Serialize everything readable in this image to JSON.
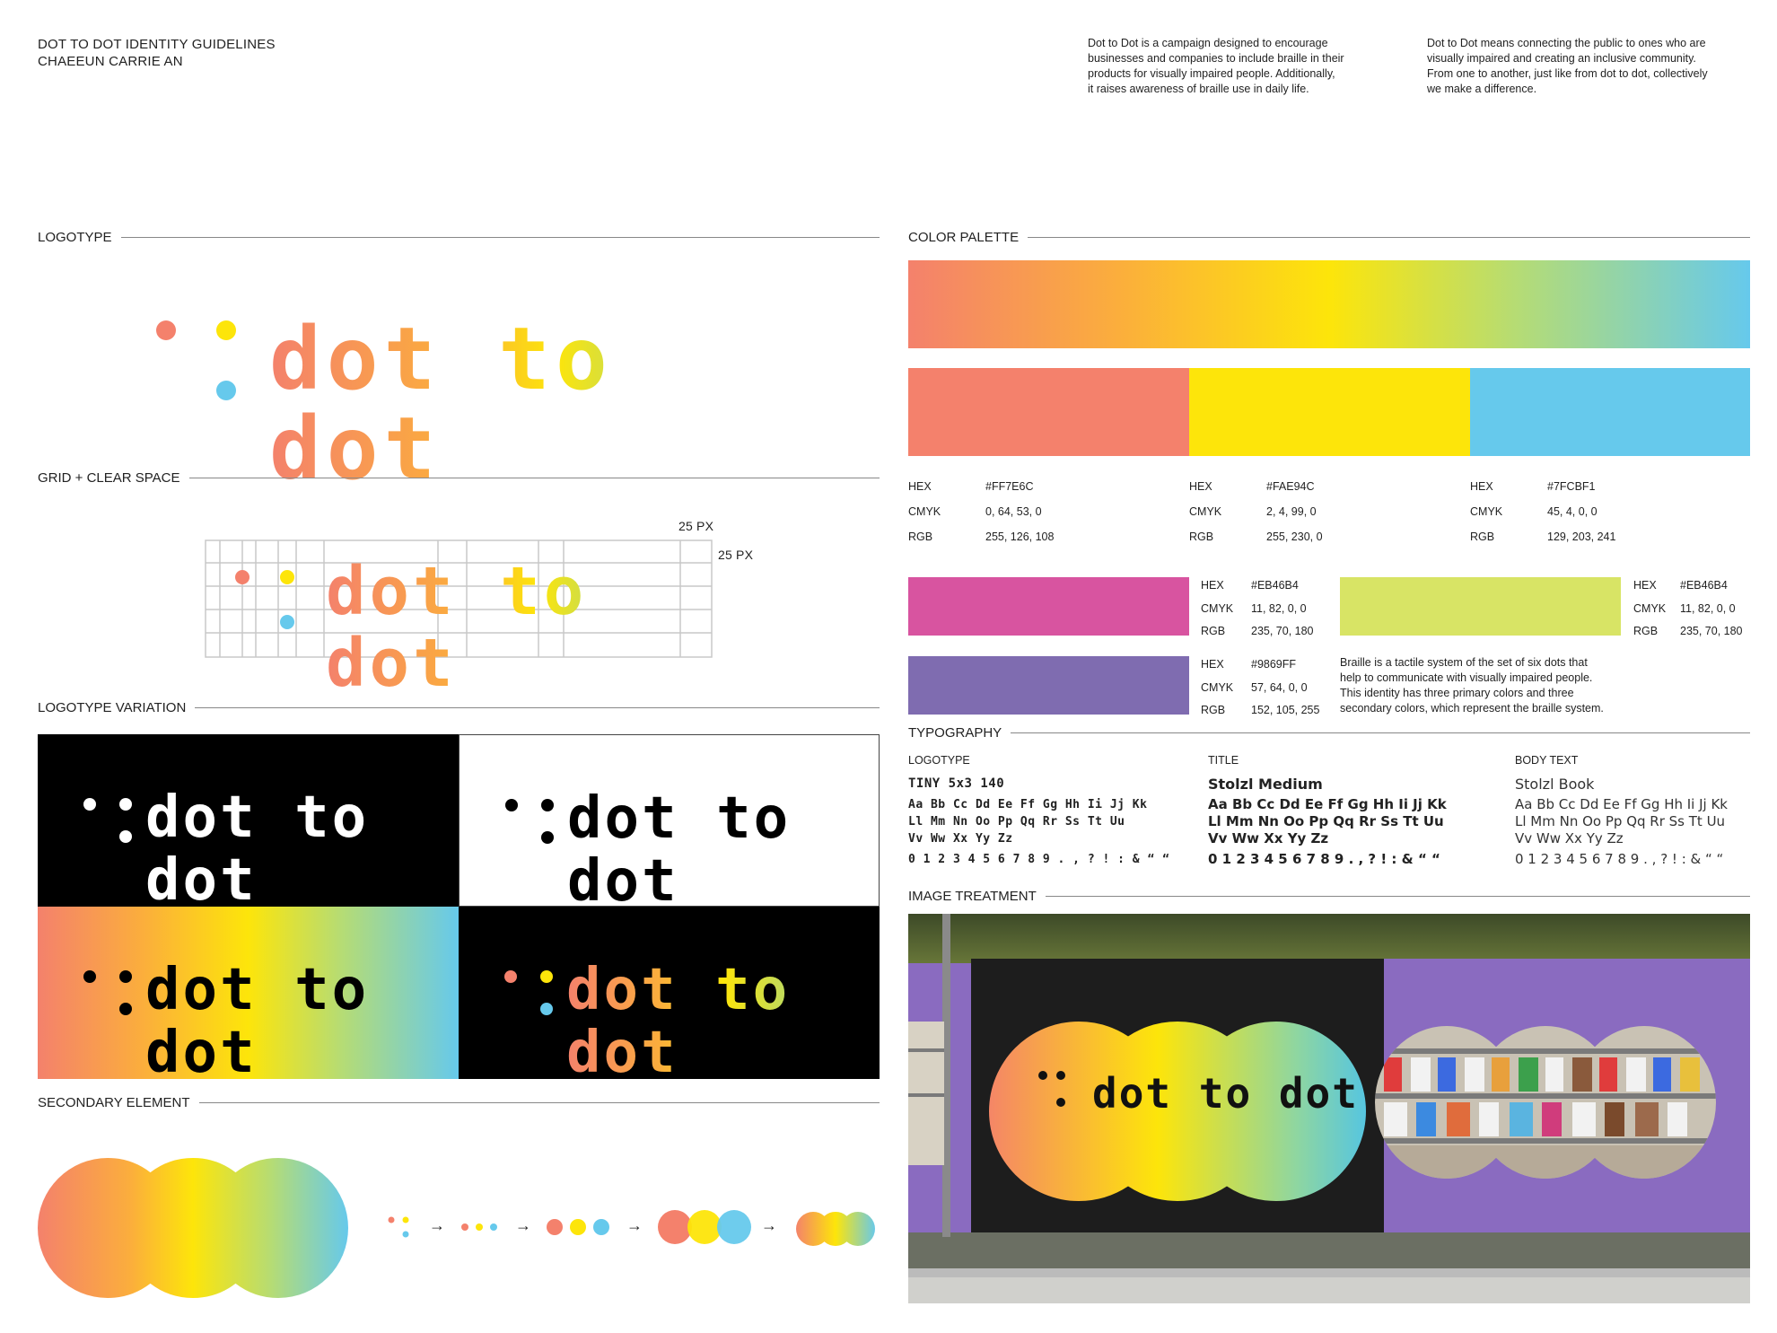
{
  "header": {
    "title_line1": "DOT TO DOT IDENTITY GUIDELINES",
    "title_line2": "CHAEEUN CARRIE AN",
    "intro1": [
      "Dot to Dot is a campaign designed to encourage",
      "businesses and companies to include braille in their",
      "products for visually impaired people. Additionally,",
      "it raises awareness of braille use in daily life."
    ],
    "intro2": [
      "Dot to Dot means connecting the public to ones who are",
      "visually impaired and creating an inclusive community.",
      "From one to another, just like from dot to dot, collectively",
      "we make a difference."
    ]
  },
  "sections": {
    "logotype": "LOGOTYPE",
    "grid": "GRID + CLEAR SPACE",
    "variation": "LOGOTYPE VARIATION",
    "secondary": "SECONDARY ELEMENT",
    "palette": "COLOR PALETTE",
    "typography": "TYPOGRAPHY",
    "image": "IMAGE TREATMENT"
  },
  "logo": {
    "wordmark": "dot to dot"
  },
  "grid": {
    "label_h": "25 PX",
    "label_v": "25 PX"
  },
  "colors": {
    "coral": "#F4816C",
    "yellow": "#FDE50A",
    "blue": "#66C9EC",
    "magenta": "#D854A0",
    "lime": "#D8E465",
    "purple": "#7F6CB0"
  },
  "primary": [
    {
      "hex_label": "HEX",
      "hex": "#FF7E6C",
      "cmyk_label": "CMYK",
      "cmyk": "0, 64, 53, 0",
      "rgb_label": "RGB",
      "rgb": "255, 126, 108"
    },
    {
      "hex_label": "HEX",
      "hex": "#FAE94C",
      "cmyk_label": "CMYK",
      "cmyk": "2, 4, 99, 0",
      "rgb_label": "RGB",
      "rgb": "255, 230, 0"
    },
    {
      "hex_label": "HEX",
      "hex": "#7FCBF1",
      "cmyk_label": "CMYK",
      "cmyk": "45, 4, 0, 0",
      "rgb_label": "RGB",
      "rgb": "129, 203, 241"
    }
  ],
  "secondary": [
    {
      "hex_label": "HEX",
      "hex": "#EB46B4",
      "cmyk_label": "CMYK",
      "cmyk": "11, 82, 0, 0",
      "rgb_label": "RGB",
      "rgb": "235, 70, 180"
    },
    {
      "hex_label": "HEX",
      "hex": "#EB46B4",
      "cmyk_label": "CMYK",
      "cmyk": "11, 82, 0, 0",
      "rgb_label": "RGB",
      "rgb": "235, 70, 180"
    },
    {
      "hex_label": "HEX",
      "hex": "#9869FF",
      "cmyk_label": "CMYK",
      "cmyk": "57, 64, 0, 0",
      "rgb_label": "RGB",
      "rgb": "152, 105, 255"
    }
  ],
  "braille_note": [
    "Braille is a tactile system of the set of six dots that",
    "help to communicate with visually impaired people.",
    "This identity has three primary colors and three",
    "secondary colors, which represent the braille system."
  ],
  "typography": {
    "logotype": {
      "label": "LOGOTYPE",
      "name": "TINY 5x3 140",
      "line1": "Aa Bb Cc Dd Ee Ff Gg Hh Ii Jj Kk",
      "line2": "Ll Mm Nn Oo Pp Qq Rr Ss Tt Uu",
      "line3": "Vv Ww Xx Yy Zz",
      "line4": "0 1 2 3 4 5 6 7 8 9 . , ? ! : & “ “"
    },
    "title": {
      "label": "TITLE",
      "name": "Stolzl Medium",
      "line1": "Aa Bb Cc Dd Ee Ff Gg Hh Ii Jj Kk",
      "line2": "Ll Mm Nn Oo Pp Qq Rr Ss Tt Uu",
      "line3": "Vv Ww Xx Yy Zz",
      "line4": "0 1 2 3 4 5 6 7 8 9 . , ? ! : & “ “"
    },
    "body": {
      "label": "BODY TEXT",
      "name": "Stolzl Book",
      "line1": "Aa Bb Cc Dd Ee Ff Gg Hh Ii Jj Kk",
      "line2": "Ll Mm Nn Oo Pp Qq Rr Ss Tt Uu",
      "line3": "Vv Ww Xx Yy Zz",
      "line4": "0 1 2 3 4 5 6 7 8 9 . , ? ! : & “ “"
    }
  },
  "arrows": [
    "→",
    "→",
    "→",
    "→"
  ]
}
